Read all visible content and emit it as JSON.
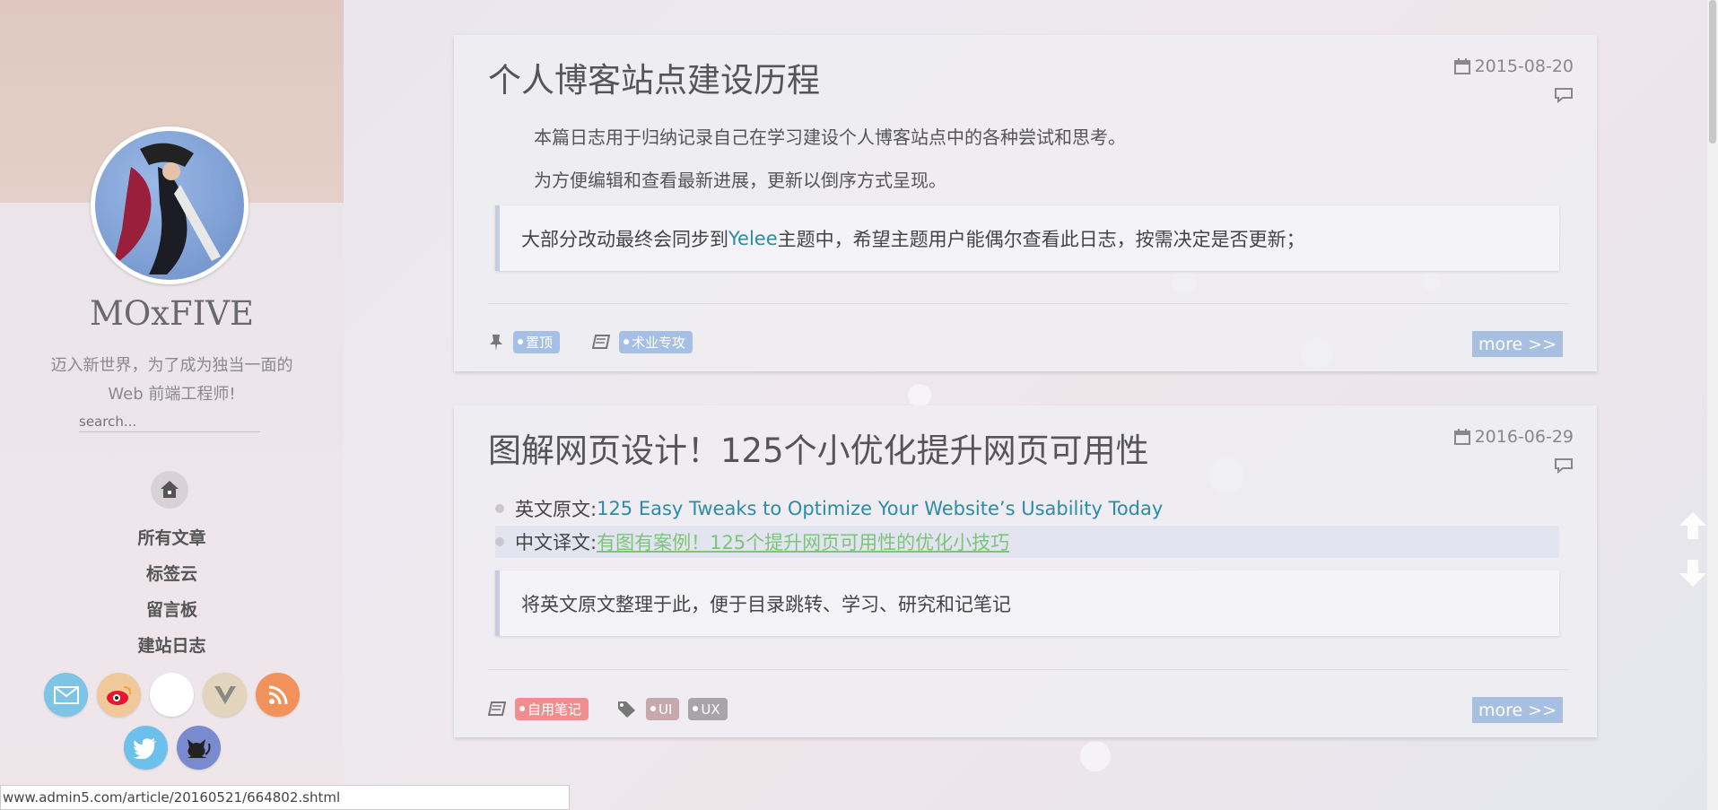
{
  "sidebar": {
    "site_name": "MOxFIVE",
    "description_line1": "迈入新世界，为了成为独当一面的",
    "description_line2": "Web 前端工程师!",
    "search_placeholder": "search...",
    "nav": [
      {
        "label": "所有文章"
      },
      {
        "label": "标签云"
      },
      {
        "label": "留言板"
      },
      {
        "label": "建站日志"
      }
    ],
    "social": [
      {
        "name": "mail-icon",
        "color": "#7ec4e6"
      },
      {
        "name": "weibo-icon",
        "color": "#f0c99b"
      },
      {
        "name": "blank-icon",
        "color": "#ffffff"
      },
      {
        "name": "v-icon",
        "color": "#e2d4bd"
      },
      {
        "name": "rss-icon",
        "color": "#f0925a"
      },
      {
        "name": "twitter-icon",
        "color": "#6ec0ec"
      },
      {
        "name": "github-cat-icon",
        "color": "#7a8acf"
      }
    ]
  },
  "posts": [
    {
      "title": "个人博客站点建设历程",
      "date": "2015-08-20",
      "para1": "本篇日志用于归纳记录自己在学习建设个人博客站点中的各种尝试和思考。",
      "para2": "为方便编辑和查看最新进展，更新以倒序方式呈现。",
      "quote_before": "大部分改动最终会同步到 ",
      "quote_link": "Yelee",
      "quote_after": " 主题中，希望主题用户能偶尔查看此日志，按需决定是否更新；",
      "tags": [
        {
          "label": "置顶",
          "color": "#a5c0e4"
        },
        {
          "label": "术业专攻",
          "color": "#a5c0e4"
        }
      ],
      "more": "more >>"
    },
    {
      "title": "图解网页设计！125个小优化提升网页可用性",
      "date": "2016-06-29",
      "bullet1_label": "英文原文: ",
      "bullet1_link": "125 Easy Tweaks to Optimize Your Website’s Usability Today",
      "bullet2_label": "中文译文: ",
      "bullet2_link": "有图有案例！125个提升网页可用性的优化小技巧",
      "quote": "将英文原文整理于此，便于目录跳转、学习、研究和记笔记",
      "tags": [
        {
          "label": "自用笔记",
          "color": "#ee8e8e"
        },
        {
          "label": "UI",
          "color": "#c7a8ad"
        },
        {
          "label": "UX",
          "color": "#a9a4aa"
        }
      ],
      "more": "more >>"
    }
  ],
  "status_bar": {
    "url": "www.admin5.com/article/20160521/664802.shtml"
  }
}
